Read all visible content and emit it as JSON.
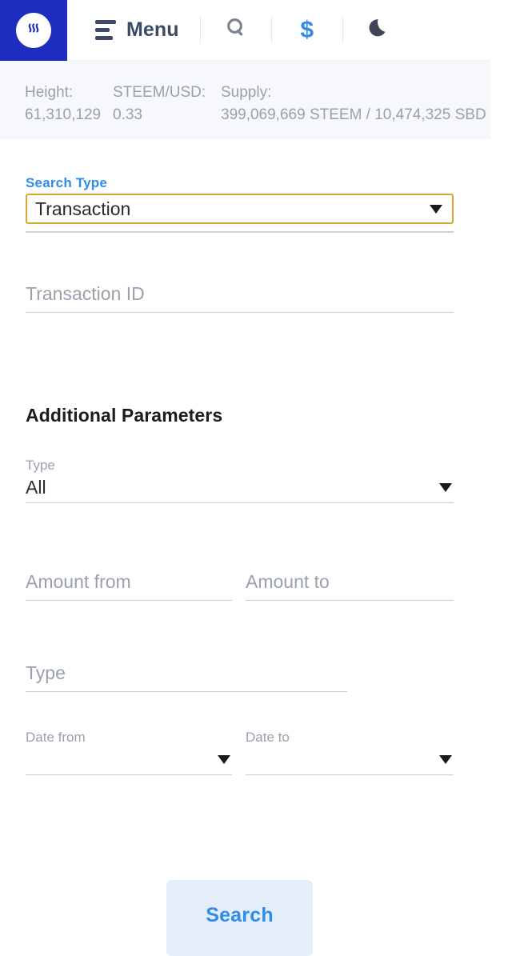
{
  "header": {
    "logo_icon": "steem-logo-icon",
    "menu_icon": "hamburger-menu-icon",
    "menu_label": "Menu",
    "search_icon": "search-icon",
    "currency_icon": "dollar-icon",
    "currency_symbol": "$",
    "theme_icon": "moon-icon",
    "brand_color": "#1e2dbe",
    "accent_color": "#2f8ce8"
  },
  "status_bar": {
    "height_label": "Height:",
    "height_value": "61,310,129",
    "price_label": "STEEM/USD:",
    "price_value": "0.33",
    "supply_label": "Supply:",
    "supply_value": "399,069,669 STEEM / 10,474,325 SBD"
  },
  "form": {
    "search_type_label": "Search Type",
    "search_type_value": "Transaction",
    "search_type_options": [
      "Transaction"
    ],
    "transaction_id_placeholder": "Transaction ID",
    "transaction_id_value": "",
    "additional_parameters_heading": "Additional Parameters",
    "type_select_label": "Type",
    "type_select_value": "All",
    "type_select_options": [
      "All"
    ],
    "amount_from_placeholder": "Amount from",
    "amount_from_value": "",
    "amount_to_placeholder": "Amount to",
    "amount_to_value": "",
    "type_input_placeholder": "Type",
    "type_input_value": "",
    "date_from_label": "Date from",
    "date_from_value": "",
    "date_to_label": "Date to",
    "date_to_value": "",
    "search_button_label": "Search",
    "focus_border_color": "#d6a92e"
  }
}
